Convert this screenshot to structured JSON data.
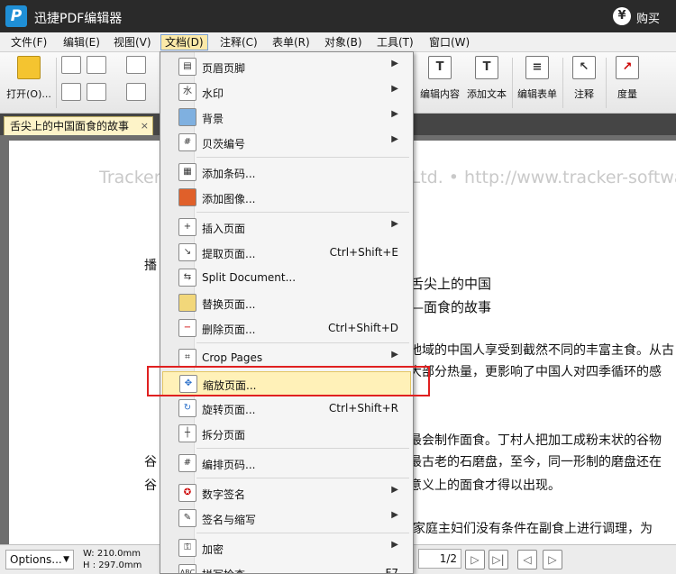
{
  "app": {
    "title": "迅捷PDF编辑器",
    "buy_label": "购买"
  },
  "menubar": [
    {
      "label": "文件(F)"
    },
    {
      "label": "编辑(E)"
    },
    {
      "label": "视图(V)"
    },
    {
      "label": "文档(D)"
    },
    {
      "label": "注释(C)"
    },
    {
      "label": "表单(R)"
    },
    {
      "label": "对象(B)"
    },
    {
      "label": "工具(T)"
    },
    {
      "label": "窗口(W)"
    }
  ],
  "toolbar": {
    "open_label": "打开(O)...",
    "edit_content_label": "编辑内容",
    "add_text_label": "添加文本",
    "edit_form_label": "编辑表单",
    "annotate_label": "注释",
    "measure_label": "度量"
  },
  "tab": {
    "label": "舌尖上的中国面食的故事",
    "close": "×"
  },
  "document": {
    "watermark": "Tracker Software Products (Canada) Ltd. • http://www.tracker-software.com",
    "lines": [
      "播",
      "舌尖上的中国",
      "——面食的故事",
      "地域的中国人享受到截然不同的丰富主食。从古",
      "大部分热量，更影响了中国人对四季循环的感",
      "最会制作面食。丁村人把加工成粉末状的谷物",
      "最古老的石磨盘，至今，同一形制的磨盘还在",
      "意义上的面食才得以出现。",
      "谷",
      "谷",
      "家庭主妇们没有条件在副食上进行调理，为"
    ]
  },
  "dropdown": {
    "items": [
      {
        "label": "页眉页脚",
        "shortcut": "",
        "submenu": true,
        "icon": "header-footer-icon"
      },
      {
        "label": "水印",
        "shortcut": "",
        "submenu": true,
        "icon": "watermark-icon"
      },
      {
        "label": "背景",
        "shortcut": "",
        "submenu": true,
        "icon": "background-icon"
      },
      {
        "label": "贝茨编号",
        "shortcut": "",
        "submenu": true,
        "icon": "bates-number-icon"
      },
      {
        "label": "添加条码...",
        "shortcut": "",
        "submenu": false,
        "icon": "barcode-icon"
      },
      {
        "label": "添加图像...",
        "shortcut": "",
        "submenu": false,
        "icon": "add-image-icon"
      },
      {
        "label": "插入页面",
        "shortcut": "",
        "submenu": true,
        "icon": "insert-page-icon"
      },
      {
        "label": "提取页面...",
        "shortcut": "Ctrl+Shift+E",
        "submenu": false,
        "icon": "extract-page-icon"
      },
      {
        "label": "Split Document...",
        "shortcut": "",
        "submenu": false,
        "icon": "split-document-icon"
      },
      {
        "label": "替换页面...",
        "shortcut": "",
        "submenu": false,
        "icon": "replace-page-icon"
      },
      {
        "label": "删除页面...",
        "shortcut": "Ctrl+Shift+D",
        "submenu": false,
        "icon": "delete-page-icon"
      },
      {
        "label": "Crop Pages",
        "shortcut": "",
        "submenu": true,
        "icon": "crop-pages-icon"
      },
      {
        "label": "缩放页面...",
        "shortcut": "",
        "submenu": false,
        "icon": "scale-page-icon"
      },
      {
        "label": "旋转页面...",
        "shortcut": "Ctrl+Shift+R",
        "submenu": false,
        "icon": "rotate-page-icon"
      },
      {
        "label": "拆分页面",
        "shortcut": "",
        "submenu": false,
        "icon": "split-page-icon"
      },
      {
        "label": "编排页码...",
        "shortcut": "",
        "submenu": false,
        "icon": "page-numbering-icon"
      },
      {
        "label": "数字签名",
        "shortcut": "",
        "submenu": true,
        "icon": "digital-signature-icon"
      },
      {
        "label": "签名与缩写",
        "shortcut": "",
        "submenu": true,
        "icon": "sign-initial-icon"
      },
      {
        "label": "加密",
        "shortcut": "",
        "submenu": true,
        "icon": "encrypt-icon"
      },
      {
        "label": "拼写检查",
        "shortcut": "F7",
        "submenu": false,
        "icon": "spell-check-icon"
      }
    ],
    "highlighted": "缩放页面..."
  },
  "statusbar": {
    "options_label": "Options...",
    "width_label": "W: 210.0mm",
    "height_label": "H : 297.0mm",
    "page_value": "1/2"
  },
  "colors": {
    "highlight": "#fff1b8",
    "callout": "#e02020",
    "titlebar": "#2a2a2a"
  }
}
